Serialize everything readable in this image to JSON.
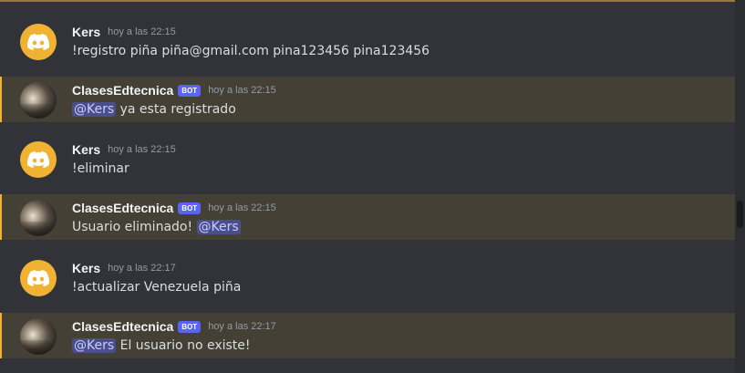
{
  "messages": [
    {
      "author": "Kers",
      "is_bot": false,
      "bot_label": "",
      "timestamp": "hoy a las 22:15",
      "text_before": "!registro piña piña@gmail.com pina123456 pina123456",
      "mention": "",
      "text_after": "",
      "highlighted": false,
      "avatar": "discord-logo-icon"
    },
    {
      "author": "ClasesEdtecnica",
      "is_bot": true,
      "bot_label": "BOT",
      "timestamp": "hoy a las 22:15",
      "text_before": "",
      "mention": "@Kers",
      "text_after": " ya esta registrado",
      "highlighted": true,
      "avatar": "photo"
    },
    {
      "author": "Kers",
      "is_bot": false,
      "bot_label": "",
      "timestamp": "hoy a las 22:15",
      "text_before": "!eliminar",
      "mention": "",
      "text_after": "",
      "highlighted": false,
      "avatar": "discord-logo-icon"
    },
    {
      "author": "ClasesEdtecnica",
      "is_bot": true,
      "bot_label": "BOT",
      "timestamp": "hoy a las 22:15",
      "text_before": "Usuario eliminado! ",
      "mention": "@Kers",
      "text_after": "",
      "highlighted": true,
      "avatar": "photo"
    },
    {
      "author": "Kers",
      "is_bot": false,
      "bot_label": "",
      "timestamp": "hoy a las 22:17",
      "text_before": "!actualizar Venezuela piña",
      "mention": "",
      "text_after": "",
      "highlighted": false,
      "avatar": "discord-logo-icon"
    },
    {
      "author": "ClasesEdtecnica",
      "is_bot": true,
      "bot_label": "BOT",
      "timestamp": "hoy a las 22:17",
      "text_before": "",
      "mention": "@Kers",
      "text_after": " El usuario no existe!",
      "highlighted": true,
      "avatar": "photo"
    }
  ],
  "colors": {
    "background": "#313338",
    "mention_highlight": "#444035",
    "mention_border": "#f0b232",
    "bot_tag": "#5865f2",
    "discord_avatar": "#f0b232"
  }
}
